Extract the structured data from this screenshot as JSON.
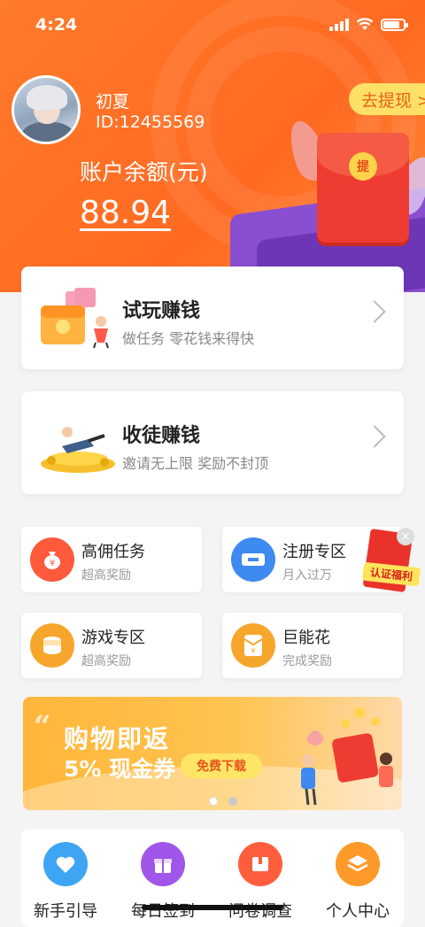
{
  "status_bar": {
    "time": "4:24",
    "battery_level": 0.8
  },
  "profile": {
    "name": "初夏",
    "id": "ID:12455569"
  },
  "balance": {
    "label": "账户余额(元)",
    "value": "88.94"
  },
  "withdraw": {
    "label": "去提现 >"
  },
  "header_art": {
    "coin_char": "提"
  },
  "cards": [
    {
      "title": "试玩赚钱",
      "subtitle": "做任务  零花钱来得快"
    },
    {
      "title": "收徒赚钱",
      "subtitle": "邀请无上限  奖励不封顶"
    }
  ],
  "zones": [
    {
      "title": "高佣任务",
      "subtitle": "超高奖励",
      "icon": "money-bag-icon",
      "color": "#ff5a3c"
    },
    {
      "title": "注册专区",
      "subtitle": "月入过万",
      "icon": "ticket-icon",
      "color": "#3e8af0"
    },
    {
      "title": "游戏专区",
      "subtitle": "超高奖励",
      "icon": "coin-stack-icon",
      "color": "#f7a62c"
    },
    {
      "title": "巨能花",
      "subtitle": "完成奖励",
      "icon": "red-envelope-icon",
      "color": "#f7a62c"
    }
  ],
  "float_badge": {
    "label": "认证福利",
    "close": "×"
  },
  "banner": {
    "title": "购物即返",
    "subtitle": "5% 现金券",
    "button": "免费下载",
    "active_dot": 0,
    "dots": 2
  },
  "bottom_nav": [
    {
      "label": "新手引导",
      "icon": "heart-icon",
      "color": "#3ea5f5"
    },
    {
      "label": "每日签到",
      "icon": "gift-icon",
      "color": "#a056e8"
    },
    {
      "label": "问卷调查",
      "icon": "box-icon",
      "color": "#ff5e3e"
    },
    {
      "label": "个人中心",
      "icon": "layers-icon",
      "color": "#ff9a2a"
    }
  ],
  "colors": {
    "brand_orange": "#ff6a22",
    "accent_yellow": "#ffe066"
  }
}
